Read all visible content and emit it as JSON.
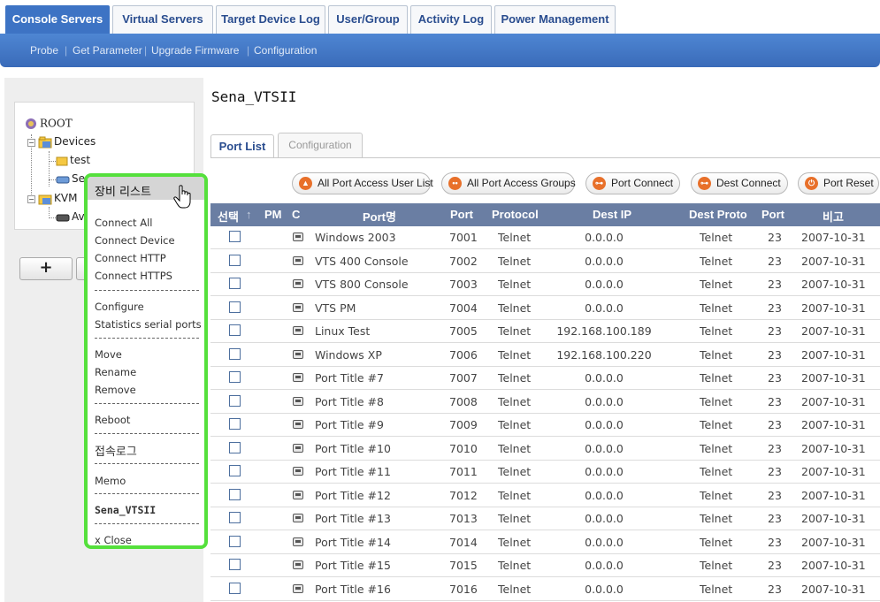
{
  "top_tabs": [
    {
      "label": "Console Servers",
      "active": true
    },
    {
      "label": "Virtual Servers",
      "active": false
    },
    {
      "label": "Target Device Log",
      "active": false
    },
    {
      "label": "User/Group",
      "active": false
    },
    {
      "label": "Activity Log",
      "active": false
    },
    {
      "label": "Power Management",
      "active": false
    }
  ],
  "sub_nav": [
    "Probe",
    "Get Parameter",
    "Upgrade Firmware",
    "Configuration"
  ],
  "tree": {
    "root": "ROOT",
    "devices": "Devices",
    "test": "test",
    "se": "Se",
    "kvm": "KVM",
    "av": "Av"
  },
  "add_button": "+",
  "context_menu": {
    "header": "장비 리스트",
    "connect_all": "Connect All",
    "connect_device": "Connect Device",
    "connect_http": "Connect HTTP",
    "connect_https": "Connect HTTPS",
    "configure": "Configure",
    "stats": "Statistics serial ports",
    "move": "Move",
    "rename": "Rename",
    "remove": "Remove",
    "reboot": "Reboot",
    "access_log": "접속로그",
    "memo": "Memo",
    "device_name": "Sena_VTSII",
    "close": "x Close"
  },
  "main": {
    "title": "Sena_VTSII",
    "tab_port_list": "Port List",
    "tab_configuration": "Configuration",
    "btn_all_users": "All Port Access User List",
    "btn_all_groups": "All Port Access Groups",
    "btn_port_connect": "Port Connect",
    "btn_dest_connect": "Dest Connect",
    "btn_port_reset": "Port Reset"
  },
  "table": {
    "headers": {
      "select": "선택",
      "sort_arrow": "↑",
      "pm": "PM",
      "c": "C",
      "port_name": "Port명",
      "port": "Port",
      "protocol": "Protocol",
      "dest_ip": "Dest IP",
      "dest_proto": "Dest Proto",
      "dest_port": "Port",
      "note": "비고"
    },
    "rows": [
      {
        "name": "Windows 2003",
        "port": "7001",
        "protocol": "Telnet",
        "dest_ip": "0.0.0.0",
        "dest_proto": "Telnet",
        "dest_port": "23",
        "note": "2007-10-31"
      },
      {
        "name": "VTS 400 Console",
        "port": "7002",
        "protocol": "Telnet",
        "dest_ip": "0.0.0.0",
        "dest_proto": "Telnet",
        "dest_port": "23",
        "note": "2007-10-31"
      },
      {
        "name": "VTS 800 Console",
        "port": "7003",
        "protocol": "Telnet",
        "dest_ip": "0.0.0.0",
        "dest_proto": "Telnet",
        "dest_port": "23",
        "note": "2007-10-31"
      },
      {
        "name": "VTS PM",
        "port": "7004",
        "protocol": "Telnet",
        "dest_ip": "0.0.0.0",
        "dest_proto": "Telnet",
        "dest_port": "23",
        "note": "2007-10-31"
      },
      {
        "name": "Linux Test",
        "port": "7005",
        "protocol": "Telnet",
        "dest_ip": "192.168.100.189",
        "dest_proto": "Telnet",
        "dest_port": "23",
        "note": "2007-10-31"
      },
      {
        "name": "Windows XP",
        "port": "7006",
        "protocol": "Telnet",
        "dest_ip": "192.168.100.220",
        "dest_proto": "Telnet",
        "dest_port": "23",
        "note": "2007-10-31"
      },
      {
        "name": "Port Title #7",
        "port": "7007",
        "protocol": "Telnet",
        "dest_ip": "0.0.0.0",
        "dest_proto": "Telnet",
        "dest_port": "23",
        "note": "2007-10-31"
      },
      {
        "name": "Port Title #8",
        "port": "7008",
        "protocol": "Telnet",
        "dest_ip": "0.0.0.0",
        "dest_proto": "Telnet",
        "dest_port": "23",
        "note": "2007-10-31"
      },
      {
        "name": "Port Title #9",
        "port": "7009",
        "protocol": "Telnet",
        "dest_ip": "0.0.0.0",
        "dest_proto": "Telnet",
        "dest_port": "23",
        "note": "2007-10-31"
      },
      {
        "name": "Port Title #10",
        "port": "7010",
        "protocol": "Telnet",
        "dest_ip": "0.0.0.0",
        "dest_proto": "Telnet",
        "dest_port": "23",
        "note": "2007-10-31"
      },
      {
        "name": "Port Title #11",
        "port": "7011",
        "protocol": "Telnet",
        "dest_ip": "0.0.0.0",
        "dest_proto": "Telnet",
        "dest_port": "23",
        "note": "2007-10-31"
      },
      {
        "name": "Port Title #12",
        "port": "7012",
        "protocol": "Telnet",
        "dest_ip": "0.0.0.0",
        "dest_proto": "Telnet",
        "dest_port": "23",
        "note": "2007-10-31"
      },
      {
        "name": "Port Title #13",
        "port": "7013",
        "protocol": "Telnet",
        "dest_ip": "0.0.0.0",
        "dest_proto": "Telnet",
        "dest_port": "23",
        "note": "2007-10-31"
      },
      {
        "name": "Port Title #14",
        "port": "7014",
        "protocol": "Telnet",
        "dest_ip": "0.0.0.0",
        "dest_proto": "Telnet",
        "dest_port": "23",
        "note": "2007-10-31"
      },
      {
        "name": "Port Title #15",
        "port": "7015",
        "protocol": "Telnet",
        "dest_ip": "0.0.0.0",
        "dest_proto": "Telnet",
        "dest_port": "23",
        "note": "2007-10-31"
      },
      {
        "name": "Port Title #16",
        "port": "7016",
        "protocol": "Telnet",
        "dest_ip": "0.0.0.0",
        "dest_proto": "Telnet",
        "dest_port": "23",
        "note": "2007-10-31"
      }
    ]
  },
  "colors": {
    "accent_blue": "#3d73c4",
    "table_header": "#6a7ea3",
    "menu_highlight": "#55e03c",
    "button_icon": "#e8702a"
  }
}
